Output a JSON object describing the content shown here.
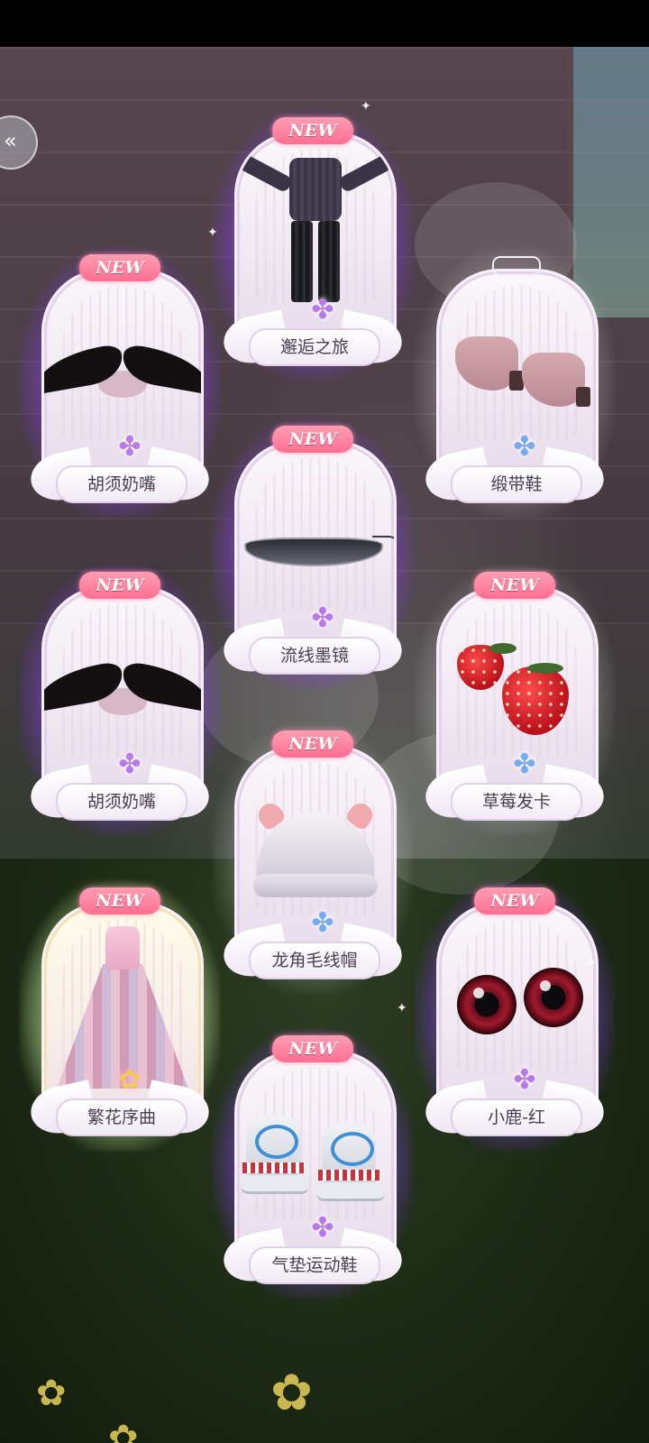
{
  "back_button": {
    "icon": "double-chevron-left-icon"
  },
  "new_label": "NEW",
  "items": [
    {
      "name": "邂逅之旅",
      "new": true,
      "rarity_gem": "purple",
      "art": "suit"
    },
    {
      "name": "胡须奶嘴",
      "new": true,
      "rarity_gem": "purple",
      "art": "mustache"
    },
    {
      "name": "缎带鞋",
      "new": false,
      "rarity_gem": "blue",
      "art": "pink-shoes"
    },
    {
      "name": "流线墨镜",
      "new": true,
      "rarity_gem": "purple",
      "art": "sunglasses"
    },
    {
      "name": "胡须奶嘴",
      "new": true,
      "rarity_gem": "purple",
      "art": "mustache"
    },
    {
      "name": "草莓发卡",
      "new": true,
      "rarity_gem": "blue",
      "art": "strawberry-clips"
    },
    {
      "name": "龙角毛线帽",
      "new": true,
      "rarity_gem": "blue",
      "art": "knit-hat"
    },
    {
      "name": "繁花序曲",
      "new": true,
      "rarity_gem": "rainbow",
      "art": "dress"
    },
    {
      "name": "小鹿-红",
      "new": true,
      "rarity_gem": "purple",
      "art": "eyes"
    },
    {
      "name": "气垫运动鞋",
      "new": true,
      "rarity_gem": "purple",
      "art": "sneakers"
    }
  ]
}
